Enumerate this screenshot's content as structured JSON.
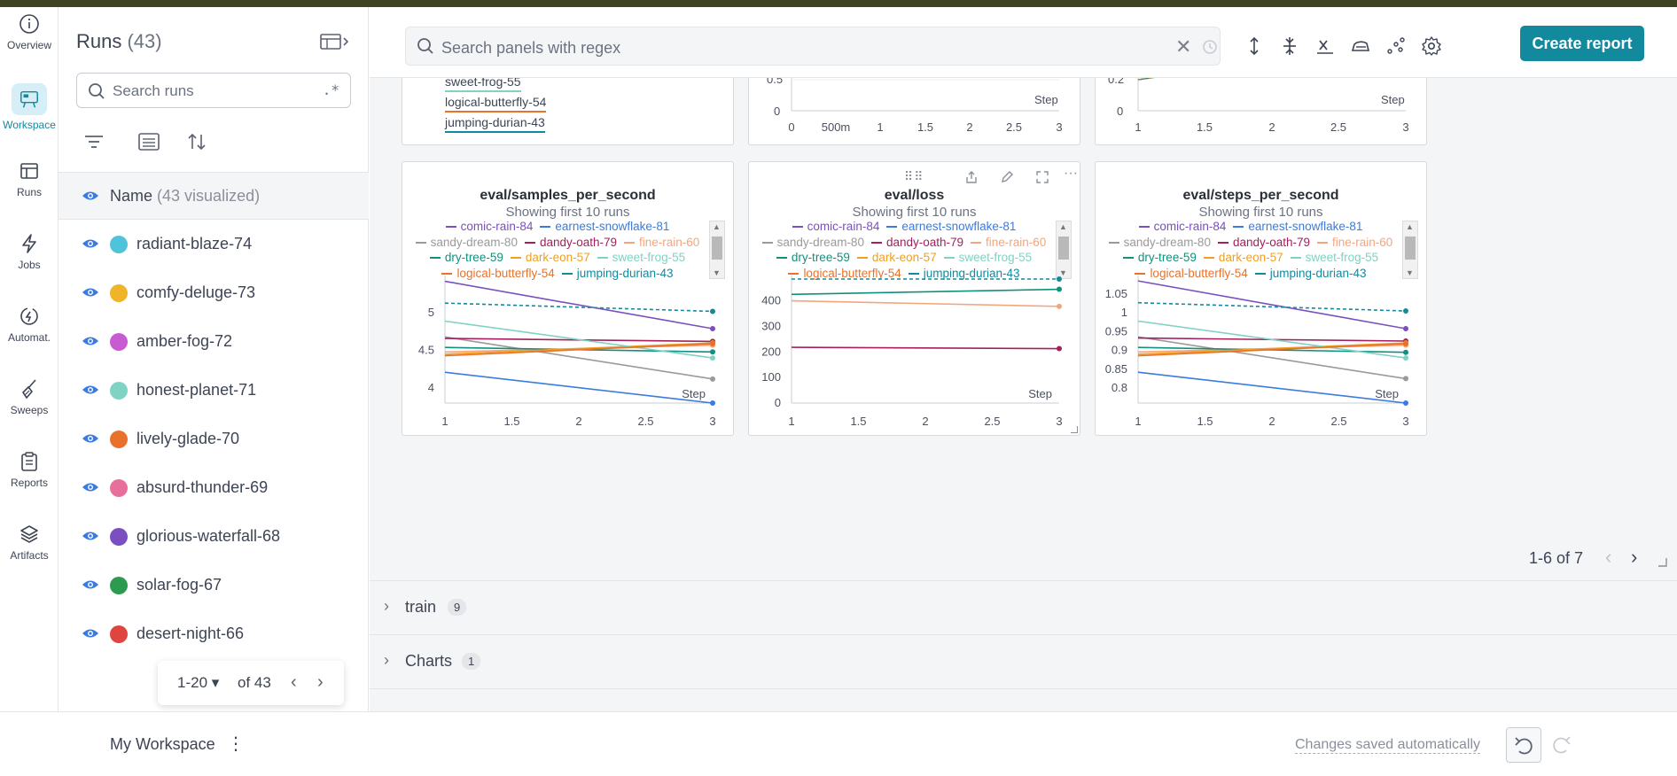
{
  "nav": {
    "items": [
      {
        "label": "Overview",
        "icon": "info-icon"
      },
      {
        "label": "Workspace",
        "icon": "workspace-icon",
        "active": true
      },
      {
        "label": "Runs",
        "icon": "table-icon"
      },
      {
        "label": "Jobs",
        "icon": "bolt-icon"
      },
      {
        "label": "Automat.",
        "icon": "automation-icon"
      },
      {
        "label": "Sweeps",
        "icon": "broom-icon"
      },
      {
        "label": "Reports",
        "icon": "clipboard-icon"
      },
      {
        "label": "Artifacts",
        "icon": "layers-icon"
      }
    ]
  },
  "runs_panel": {
    "title": "Runs",
    "count": "(43)",
    "search_placeholder": "Search runs",
    "regex_label": ".*",
    "name_header": "Name",
    "name_sub": "(43 visualized)",
    "runs": [
      {
        "name": "radiant-blaze-74",
        "color": "#4fc3d9"
      },
      {
        "name": "comfy-deluge-73",
        "color": "#f0b429"
      },
      {
        "name": "amber-fog-72",
        "color": "#c85bd1"
      },
      {
        "name": "honest-planet-71",
        "color": "#7fd3c2"
      },
      {
        "name": "lively-glade-70",
        "color": "#e8722c"
      },
      {
        "name": "absurd-thunder-69",
        "color": "#e86e9c"
      },
      {
        "name": "glorious-waterfall-68",
        "color": "#7a4fc0"
      },
      {
        "name": "solar-fog-67",
        "color": "#2e9a50"
      },
      {
        "name": "desert-night-66",
        "color": "#e0443e"
      }
    ],
    "pager": {
      "range": "1-20",
      "of": "of 43"
    }
  },
  "toolbar": {
    "search_placeholder": "Search panels with regex",
    "create_report": "Create report"
  },
  "top_legend": {
    "items": [
      {
        "name": "sweet-frog-55",
        "color": "#7fd3c2"
      },
      {
        "name": "logical-butterfly-54",
        "color": "#e8722c"
      },
      {
        "name": "jumping-durian-43",
        "color": "#13899e"
      }
    ]
  },
  "top_axes": {
    "mid": {
      "y": [
        "0.5",
        "0"
      ],
      "x": [
        "0",
        "500m",
        "1",
        "1.5",
        "2",
        "2.5",
        "3"
      ],
      "label": "Step"
    },
    "right": {
      "y": [
        "0.2",
        "0"
      ],
      "x": [
        "1",
        "1.5",
        "2",
        "2.5",
        "3"
      ],
      "label": "Step"
    }
  },
  "legend_rows": [
    [
      {
        "name": "comic-rain-84",
        "color": "#7a4fc0"
      },
      {
        "name": "earnest-snowflake-81",
        "color": "#3b7be0"
      }
    ],
    [
      {
        "name": "sandy-dream-80",
        "color": "#9a9a9a"
      },
      {
        "name": "dandy-oath-79",
        "color": "#a3205c"
      },
      {
        "name": "fine-rain-60",
        "color": "#f4a57c"
      }
    ],
    [
      {
        "name": "dry-tree-59",
        "color": "#12907e"
      },
      {
        "name": "dark-eon-57",
        "color": "#f0a020"
      },
      {
        "name": "sweet-frog-55",
        "color": "#7fd3c2"
      }
    ],
    [
      {
        "name": "logical-butterfly-54",
        "color": "#e8722c"
      },
      {
        "name": "jumping-durian-43",
        "color": "#13899e",
        "dash": true
      }
    ]
  ],
  "charts": [
    {
      "title": "eval/samples_per_second",
      "subtitle": "Showing first 10 runs",
      "xlabel": "Step",
      "x_ticks": [
        "1",
        "1.5",
        "2",
        "2.5",
        "3"
      ],
      "y_ticks": [
        "5",
        "4.5",
        "4"
      ],
      "chart_data": {
        "type": "line",
        "x": [
          1,
          3
        ],
        "ylim": [
          3.8,
          5.45
        ],
        "series": [
          {
            "name": "comic-rain-84",
            "values": [
              5.42,
              4.79
            ]
          },
          {
            "name": "earnest-snowflake-81",
            "values": [
              4.21,
              3.8
            ]
          },
          {
            "name": "sandy-dream-80",
            "values": [
              4.68,
              4.12
            ]
          },
          {
            "name": "dandy-oath-79",
            "values": [
              4.66,
              4.62
            ]
          },
          {
            "name": "fine-rain-60",
            "values": [
              4.48,
              4.57
            ]
          },
          {
            "name": "dry-tree-59",
            "values": [
              4.54,
              4.48
            ]
          },
          {
            "name": "dark-eon-57",
            "values": [
              4.45,
              4.6
            ]
          },
          {
            "name": "sweet-frog-55",
            "values": [
              4.89,
              4.4
            ]
          },
          {
            "name": "logical-butterfly-54",
            "values": [
              4.43,
              4.59
            ]
          },
          {
            "name": "jumping-durian-43",
            "values": [
              5.13,
              5.02
            ]
          }
        ]
      }
    },
    {
      "title": "eval/loss",
      "subtitle": "Showing first 10 runs",
      "xlabel": "Step",
      "x_ticks": [
        "1",
        "1.5",
        "2",
        "2.5",
        "3"
      ],
      "y_ticks": [
        "400",
        "300",
        "200",
        "100",
        "0"
      ],
      "chart_data": {
        "type": "line",
        "x": [
          1,
          3
        ],
        "ylim": [
          0,
          485
        ],
        "series": [
          {
            "name": "dry-tree-59",
            "values": [
              425,
              445
            ]
          },
          {
            "name": "fine-rain-60",
            "values": [
              400,
              378
            ]
          },
          {
            "name": "dandy-oath-79",
            "values": [
              218,
              213
            ]
          },
          {
            "name": "jumping-durian-43",
            "values": [
              485,
              485
            ]
          }
        ]
      }
    },
    {
      "title": "eval/steps_per_second",
      "subtitle": "Showing first 10 runs",
      "xlabel": "Step",
      "x_ticks": [
        "1",
        "1.5",
        "2",
        "2.5",
        "3"
      ],
      "y_ticks": [
        "1.05",
        "1",
        "0.95",
        "0.9",
        "0.85",
        "0.8"
      ],
      "chart_data": {
        "type": "line",
        "x": [
          1,
          3
        ],
        "ylim": [
          0.76,
          1.09
        ],
        "series": [
          {
            "name": "comic-rain-84",
            "values": [
              1.085,
              0.958
            ]
          },
          {
            "name": "earnest-snowflake-81",
            "values": [
              0.842,
              0.76
            ]
          },
          {
            "name": "sandy-dream-80",
            "values": [
              0.936,
              0.825
            ]
          },
          {
            "name": "dandy-oath-79",
            "values": [
              0.933,
              0.925
            ]
          },
          {
            "name": "fine-rain-60",
            "values": [
              0.896,
              0.914
            ]
          },
          {
            "name": "dry-tree-59",
            "values": [
              0.908,
              0.895
            ]
          },
          {
            "name": "dark-eon-57",
            "values": [
              0.89,
              0.92
            ]
          },
          {
            "name": "sweet-frog-55",
            "values": [
              0.978,
              0.88
            ]
          },
          {
            "name": "logical-butterfly-54",
            "values": [
              0.886,
              0.918
            ]
          },
          {
            "name": "jumping-durian-43",
            "values": [
              1.027,
              1.005
            ]
          }
        ]
      }
    }
  ],
  "pagination": {
    "label": "1-6 of 7"
  },
  "sections": [
    {
      "title": "train",
      "count": "9"
    },
    {
      "title": "Charts",
      "count": "1"
    }
  ],
  "bottom": {
    "workspace": "My Workspace",
    "saved": "Changes saved automatically"
  },
  "colors": {
    "accent": "#13899e",
    "accent_bg": "#d6eef5"
  }
}
